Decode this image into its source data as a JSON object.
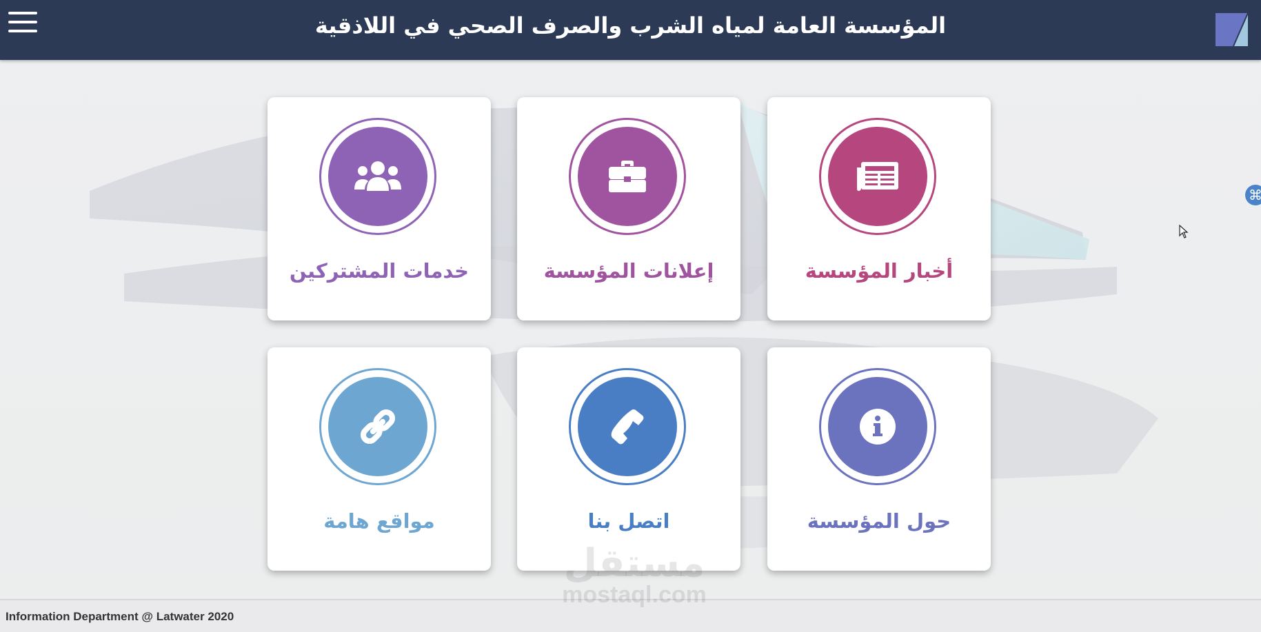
{
  "header": {
    "title": "المؤسسة العامة لمياه الشرب والصرف الصحي في اللاذقية",
    "menu_icon": "hamburger-menu-icon",
    "logo_icon": "latwater-logo",
    "background_color": "#2d3a56"
  },
  "tiles": [
    {
      "label": "أخبار المؤسسة",
      "icon": "newspaper-icon",
      "color": "#b5467e"
    },
    {
      "label": "إعلانات المؤسسة",
      "icon": "briefcase-icon",
      "color": "#a0539e"
    },
    {
      "label": "خدمات المشتركين",
      "icon": "users-icon",
      "color": "#8e62b4"
    },
    {
      "label": "حول المؤسسة",
      "icon": "info-icon",
      "color": "#6b72be"
    },
    {
      "label": "اتصل بنا",
      "icon": "phone-icon",
      "color": "#4a7ec4"
    },
    {
      "label": "مواقع هامة",
      "icon": "link-icon",
      "color": "#6ea6d2"
    }
  ],
  "footer": {
    "text": "Information Department @ Latwater 2020"
  },
  "watermark": {
    "arabic": "مستقل",
    "latin": "mostaql.com"
  },
  "floating_badge": {
    "symbol": "⌘",
    "icon": "command-icon"
  }
}
